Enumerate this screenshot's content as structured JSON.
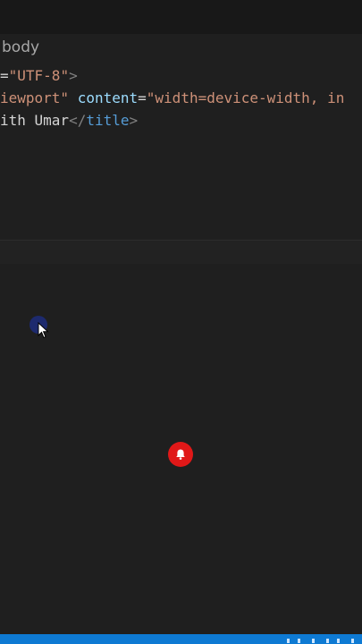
{
  "breadcrumb": {
    "text": "body"
  },
  "code": {
    "line1": {
      "prefix": "=",
      "value": "\"UTF-8\"",
      "close": ">"
    },
    "line2": {
      "value_tail": "iewport\"",
      "attr": "content",
      "eq": "=",
      "content_value": "\"width=device-width, in"
    },
    "line3": {
      "text": "ith Umar",
      "close_tag_open": "</",
      "tag_name": "title",
      "close_tag_end": ">"
    }
  },
  "icons": {
    "cursor": "mouse-pointer-icon",
    "bell": "bell-icon"
  },
  "colors": {
    "editor_bg": "#1f1f1f",
    "string": "#ce9178",
    "attribute": "#9cdcfe",
    "tag": "#569cd6",
    "notification": "#e01818",
    "status_bar": "#0e7ad3"
  }
}
